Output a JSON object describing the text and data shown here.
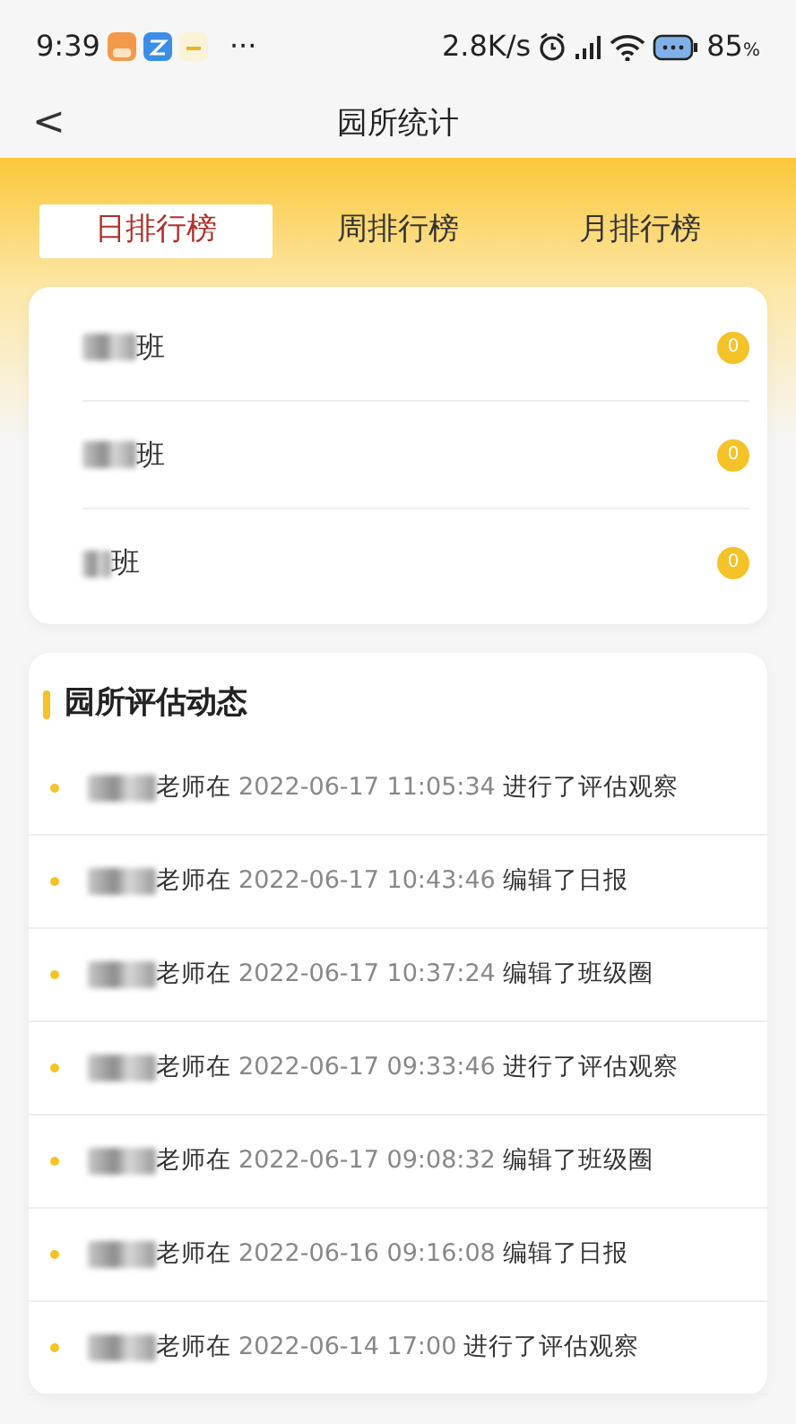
{
  "status_bar": {
    "time": "9:39",
    "more": "···",
    "speed": "2.8K/s",
    "battery": "85",
    "battery_unit": "%"
  },
  "header": {
    "back": "<",
    "title": "园所统计"
  },
  "tabs": [
    {
      "label": "日排行榜",
      "selected": true
    },
    {
      "label": "周排行榜",
      "selected": false
    },
    {
      "label": "月排行榜",
      "selected": false
    }
  ],
  "classes": [
    {
      "name": "班",
      "count": "0"
    },
    {
      "name": "班",
      "count": "0"
    },
    {
      "name": "班",
      "count": "0"
    }
  ],
  "activity": {
    "title": "园所评估动态",
    "items": [
      {
        "teacher": "老师在",
        "time": "2022-06-17 11:05:34",
        "action": "进行了评估观察"
      },
      {
        "teacher": "老师在",
        "time": "2022-06-17 10:43:46",
        "action": "编辑了日报"
      },
      {
        "teacher": "老师在",
        "time": "2022-06-17 10:37:24",
        "action": "编辑了班级圈"
      },
      {
        "teacher": "老师在",
        "time": "2022-06-17 09:33:46",
        "action": "进行了评估观察"
      },
      {
        "teacher": "老师在",
        "time": "2022-06-17 09:08:32",
        "action": "编辑了班级圈"
      },
      {
        "teacher": "老师在",
        "time": "2022-06-16 09:16:08",
        "action": "编辑了日报"
      },
      {
        "teacher": "老师在",
        "time": "2022-06-14 17:00",
        "action": "进行了评估观察"
      }
    ]
  }
}
